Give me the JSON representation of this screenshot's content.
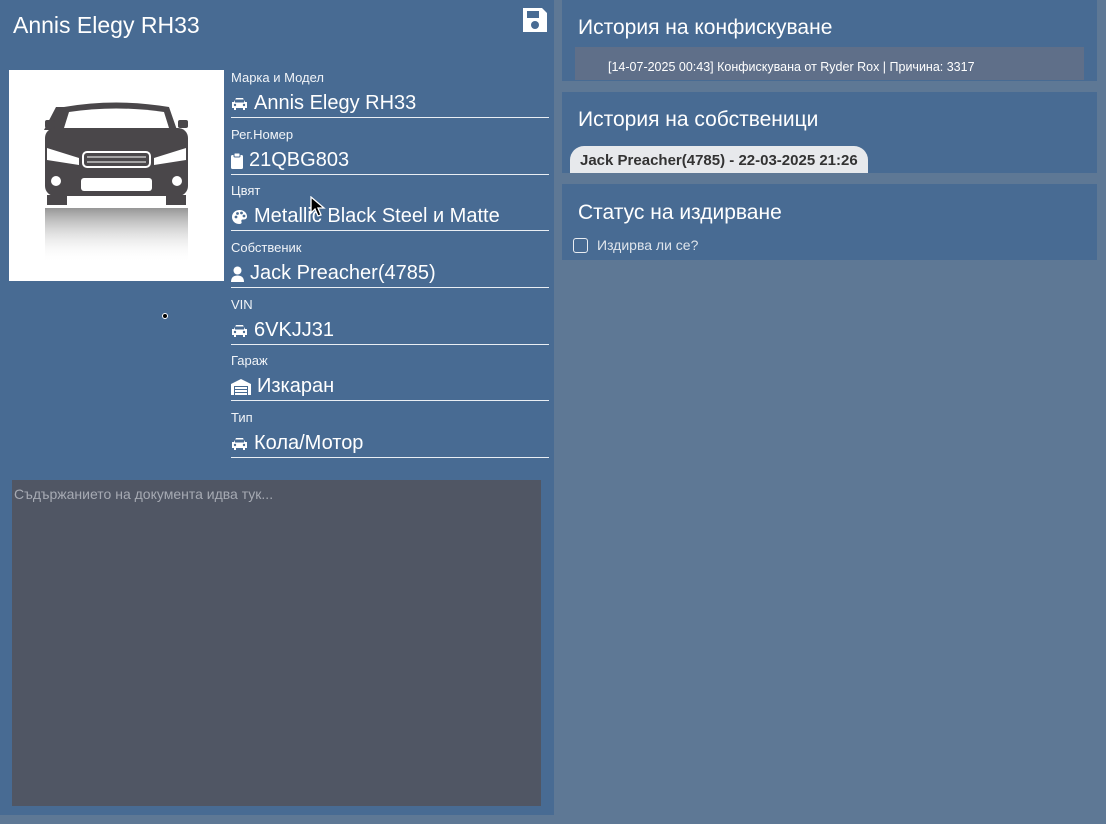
{
  "vehicle": {
    "title": "Annis Elegy RH33",
    "fields": [
      {
        "label": "Марка и Модел",
        "value": "Annis Elegy RH33",
        "icon": "car-icon"
      },
      {
        "label": "Рег.Номер",
        "value": "21QBG803",
        "icon": "clipboard-icon"
      },
      {
        "label": "Цвят",
        "value": "Metallic Black Steel и Matte",
        "icon": "palette-icon"
      },
      {
        "label": "Собственик",
        "value": "Jack Preacher(4785)",
        "icon": "user-icon"
      },
      {
        "label": "VIN",
        "value": "6VKJJ31",
        "icon": "car-icon"
      },
      {
        "label": "Гараж",
        "value": "Изкаран",
        "icon": "warehouse-icon"
      },
      {
        "label": "Тип",
        "value": "Кола/Мотор",
        "icon": "car-icon"
      }
    ]
  },
  "document": {
    "placeholder": "Съдържанието на документа идва тук..."
  },
  "confiscation": {
    "title": "История на конфискуване",
    "entries": [
      "[14-07-2025 00:43] Конфискувана от Ryder Rox | Причина: 3317"
    ]
  },
  "owners": {
    "title": "История на собственици",
    "entries": [
      "Jack Preacher(4785) - 22-03-2025 21:26"
    ]
  },
  "wanted": {
    "title": "Статус на издирване",
    "checkbox_label": "Издирва ли се?",
    "checked": false
  },
  "colors": {
    "background": "#5e7895",
    "panel": "#486b93",
    "document_area": "#505664",
    "confiscation_entry": "#5f6f89",
    "owner_chip": "#e7e9ec"
  },
  "icons": {
    "save": "floppy-disk-icon"
  }
}
